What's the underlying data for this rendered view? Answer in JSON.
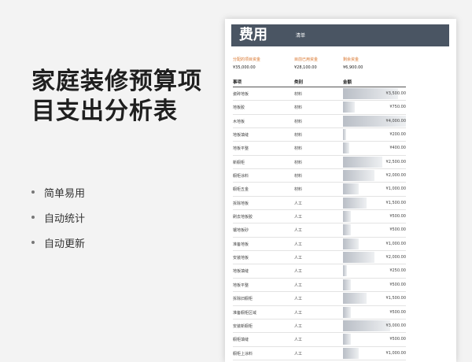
{
  "left_panel": {
    "title_line1": "家庭装修预算项",
    "title_line2": "目支出分析表",
    "bullets": [
      "简单易用",
      "自动统计",
      "自动更新"
    ]
  },
  "sheet": {
    "banner_title": "费用",
    "banner_subtitle": "清单",
    "accent_color": "#d9742b",
    "banner_color": "#4a5563",
    "summary": [
      {
        "label": "分配的项目资金",
        "value": "¥35,000.00"
      },
      {
        "label": "目前已用资金",
        "value": "¥28,100.00"
      },
      {
        "label": "剩余资金",
        "value": "¥6,900.00"
      }
    ],
    "columns": [
      "事项",
      "类别",
      "金额"
    ],
    "rows": [
      {
        "item": "瓷砖地板",
        "category": "材料",
        "amount": "¥3,500.00",
        "value": 3500
      },
      {
        "item": "地板胶",
        "category": "材料",
        "amount": "¥750.00",
        "value": 750
      },
      {
        "item": "木地板",
        "category": "材料",
        "amount": "¥4,000.00",
        "value": 4000
      },
      {
        "item": "地板填缝",
        "category": "材料",
        "amount": "¥200.00",
        "value": 200
      },
      {
        "item": "地板平整",
        "category": "材料",
        "amount": "¥400.00",
        "value": 400
      },
      {
        "item": "新橱柜",
        "category": "材料",
        "amount": "¥2,500.00",
        "value": 2500
      },
      {
        "item": "橱柜涂料",
        "category": "材料",
        "amount": "¥2,000.00",
        "value": 2000
      },
      {
        "item": "橱柜五金",
        "category": "材料",
        "amount": "¥1,000.00",
        "value": 1000
      },
      {
        "item": "拆除地板",
        "category": "人工",
        "amount": "¥1,500.00",
        "value": 1500
      },
      {
        "item": "刷去地板胶",
        "category": "人工",
        "amount": "¥500.00",
        "value": 500
      },
      {
        "item": "镶地板砂",
        "category": "人工",
        "amount": "¥500.00",
        "value": 500
      },
      {
        "item": "准备地板",
        "category": "人工",
        "amount": "¥1,000.00",
        "value": 1000
      },
      {
        "item": "安装地板",
        "category": "人工",
        "amount": "¥2,000.00",
        "value": 2000
      },
      {
        "item": "地板填缝",
        "category": "人工",
        "amount": "¥250.00",
        "value": 250
      },
      {
        "item": "地板平整",
        "category": "人工",
        "amount": "¥500.00",
        "value": 500
      },
      {
        "item": "拆除旧橱柜",
        "category": "人工",
        "amount": "¥1,500.00",
        "value": 1500
      },
      {
        "item": "准备橱柜区域",
        "category": "人工",
        "amount": "¥500.00",
        "value": 500
      },
      {
        "item": "安装新橱柜",
        "category": "人工",
        "amount": "¥3,000.00",
        "value": 3000
      },
      {
        "item": "橱柜填缝",
        "category": "人工",
        "amount": "¥500.00",
        "value": 500
      },
      {
        "item": "橱柜上涂料",
        "category": "人工",
        "amount": "¥1,000.00",
        "value": 1000
      }
    ]
  }
}
